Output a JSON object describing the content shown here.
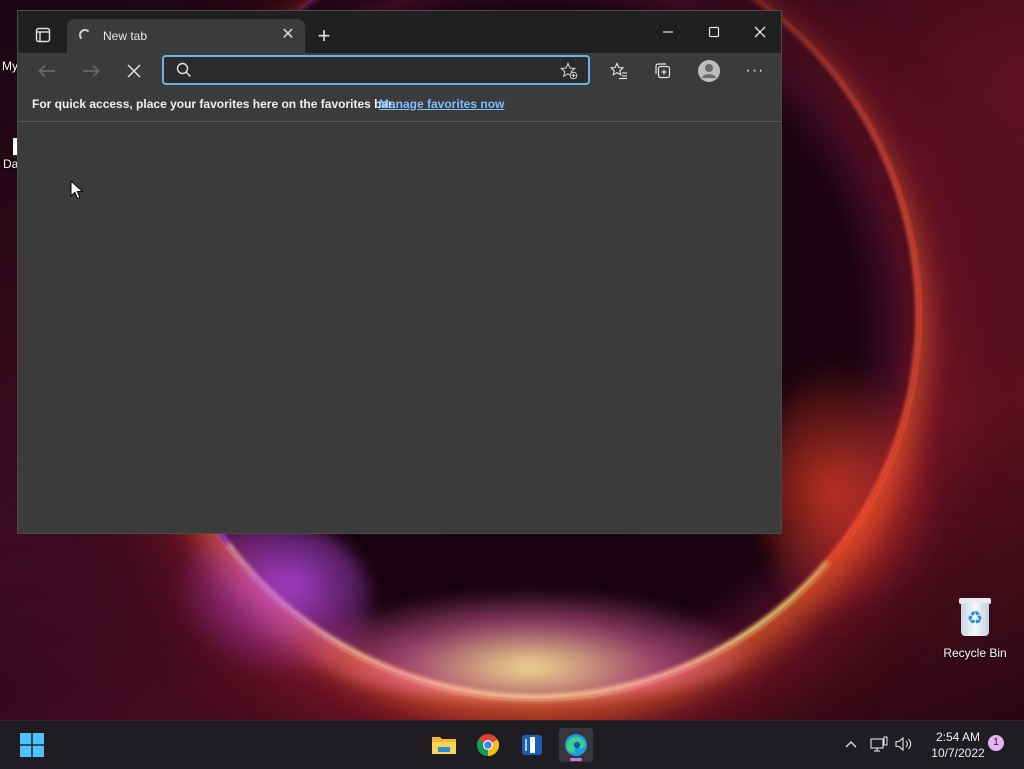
{
  "desktop": {
    "partial_labels": [
      "My",
      "Da"
    ],
    "recycle_bin": {
      "label": "Recycle Bin"
    }
  },
  "browser": {
    "tab": {
      "title": "New tab",
      "loading": true
    },
    "address_bar": {
      "value": "",
      "placeholder": ""
    },
    "favorites_bar": {
      "message": "For quick access, place your favorites here on the favorites bar.",
      "link": "Manage favorites now"
    },
    "accent_color": "#6cb4e4"
  },
  "taskbar": {
    "apps": [
      "file-explorer",
      "google-chrome",
      "app-blue-bar",
      "microsoft-edge"
    ],
    "active_app": "microsoft-edge",
    "clock": {
      "time": "2:54 AM",
      "date": "10/7/2022"
    },
    "notification_count": "1"
  }
}
